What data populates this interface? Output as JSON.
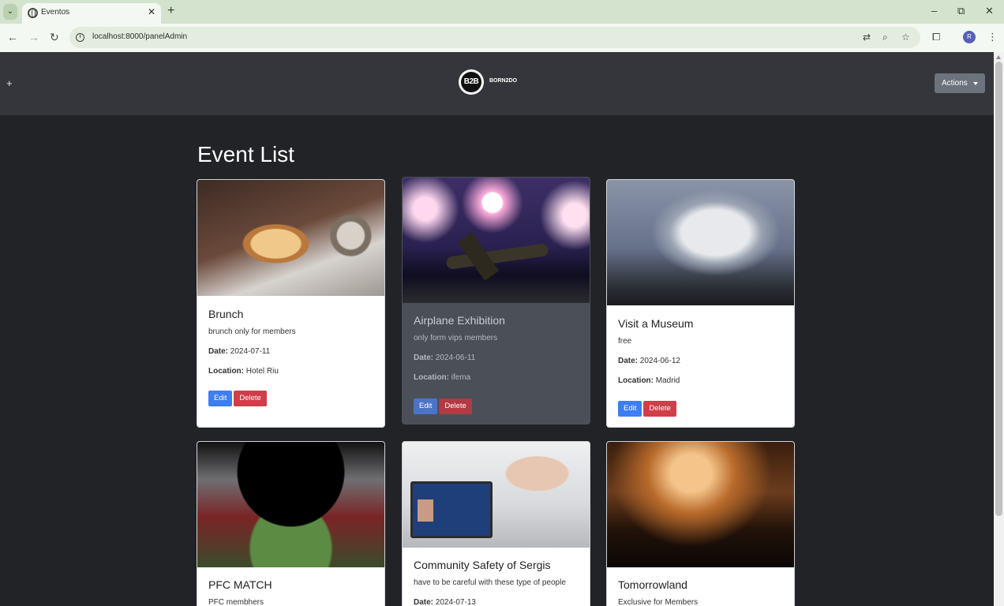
{
  "browser": {
    "tab_search_icon": "chevron-down-icon",
    "tab_title": "Eventos",
    "tab_close": "✕",
    "new_tab": "+",
    "minimize": "–",
    "restore": "⧉",
    "close": "✕",
    "url": "localhost:8000/panelAdmin",
    "profile_initial": "R"
  },
  "header": {
    "menu_toggle": "+",
    "logo_mark": "B2B",
    "logo_text": "BORN2DO",
    "actions_label": "Actions"
  },
  "page": {
    "title": "Event List"
  },
  "labels": {
    "date": "Date:",
    "location": "Location:",
    "edit": "Edit",
    "delete": "Delete"
  },
  "events": [
    {
      "title": "Brunch",
      "description": "brunch only for members",
      "date": "2024-07-11",
      "location": "Hotel Riu"
    },
    {
      "title": "Airplane Exhibition",
      "description": "only form vips members",
      "date": "2024-06-11",
      "location": "ifema"
    },
    {
      "title": "Visit a Museum",
      "description": "free",
      "date": "2024-06-12",
      "location": "Madrid"
    },
    {
      "title": "PFC MATCH",
      "description": "PFC membhers"
    },
    {
      "title": "Community Safety of Sergis",
      "description": "have to be careful with these type of people",
      "date": "2024-07-13"
    },
    {
      "title": "Tomorrowland",
      "description": "Exclusive for Members"
    }
  ],
  "colors": {
    "page_bg": "#222327",
    "header_bg": "#34363b",
    "edit_button": "#3d7ef2",
    "delete_button": "#d13d49",
    "highlighted_card_bg": "#4b5058"
  }
}
